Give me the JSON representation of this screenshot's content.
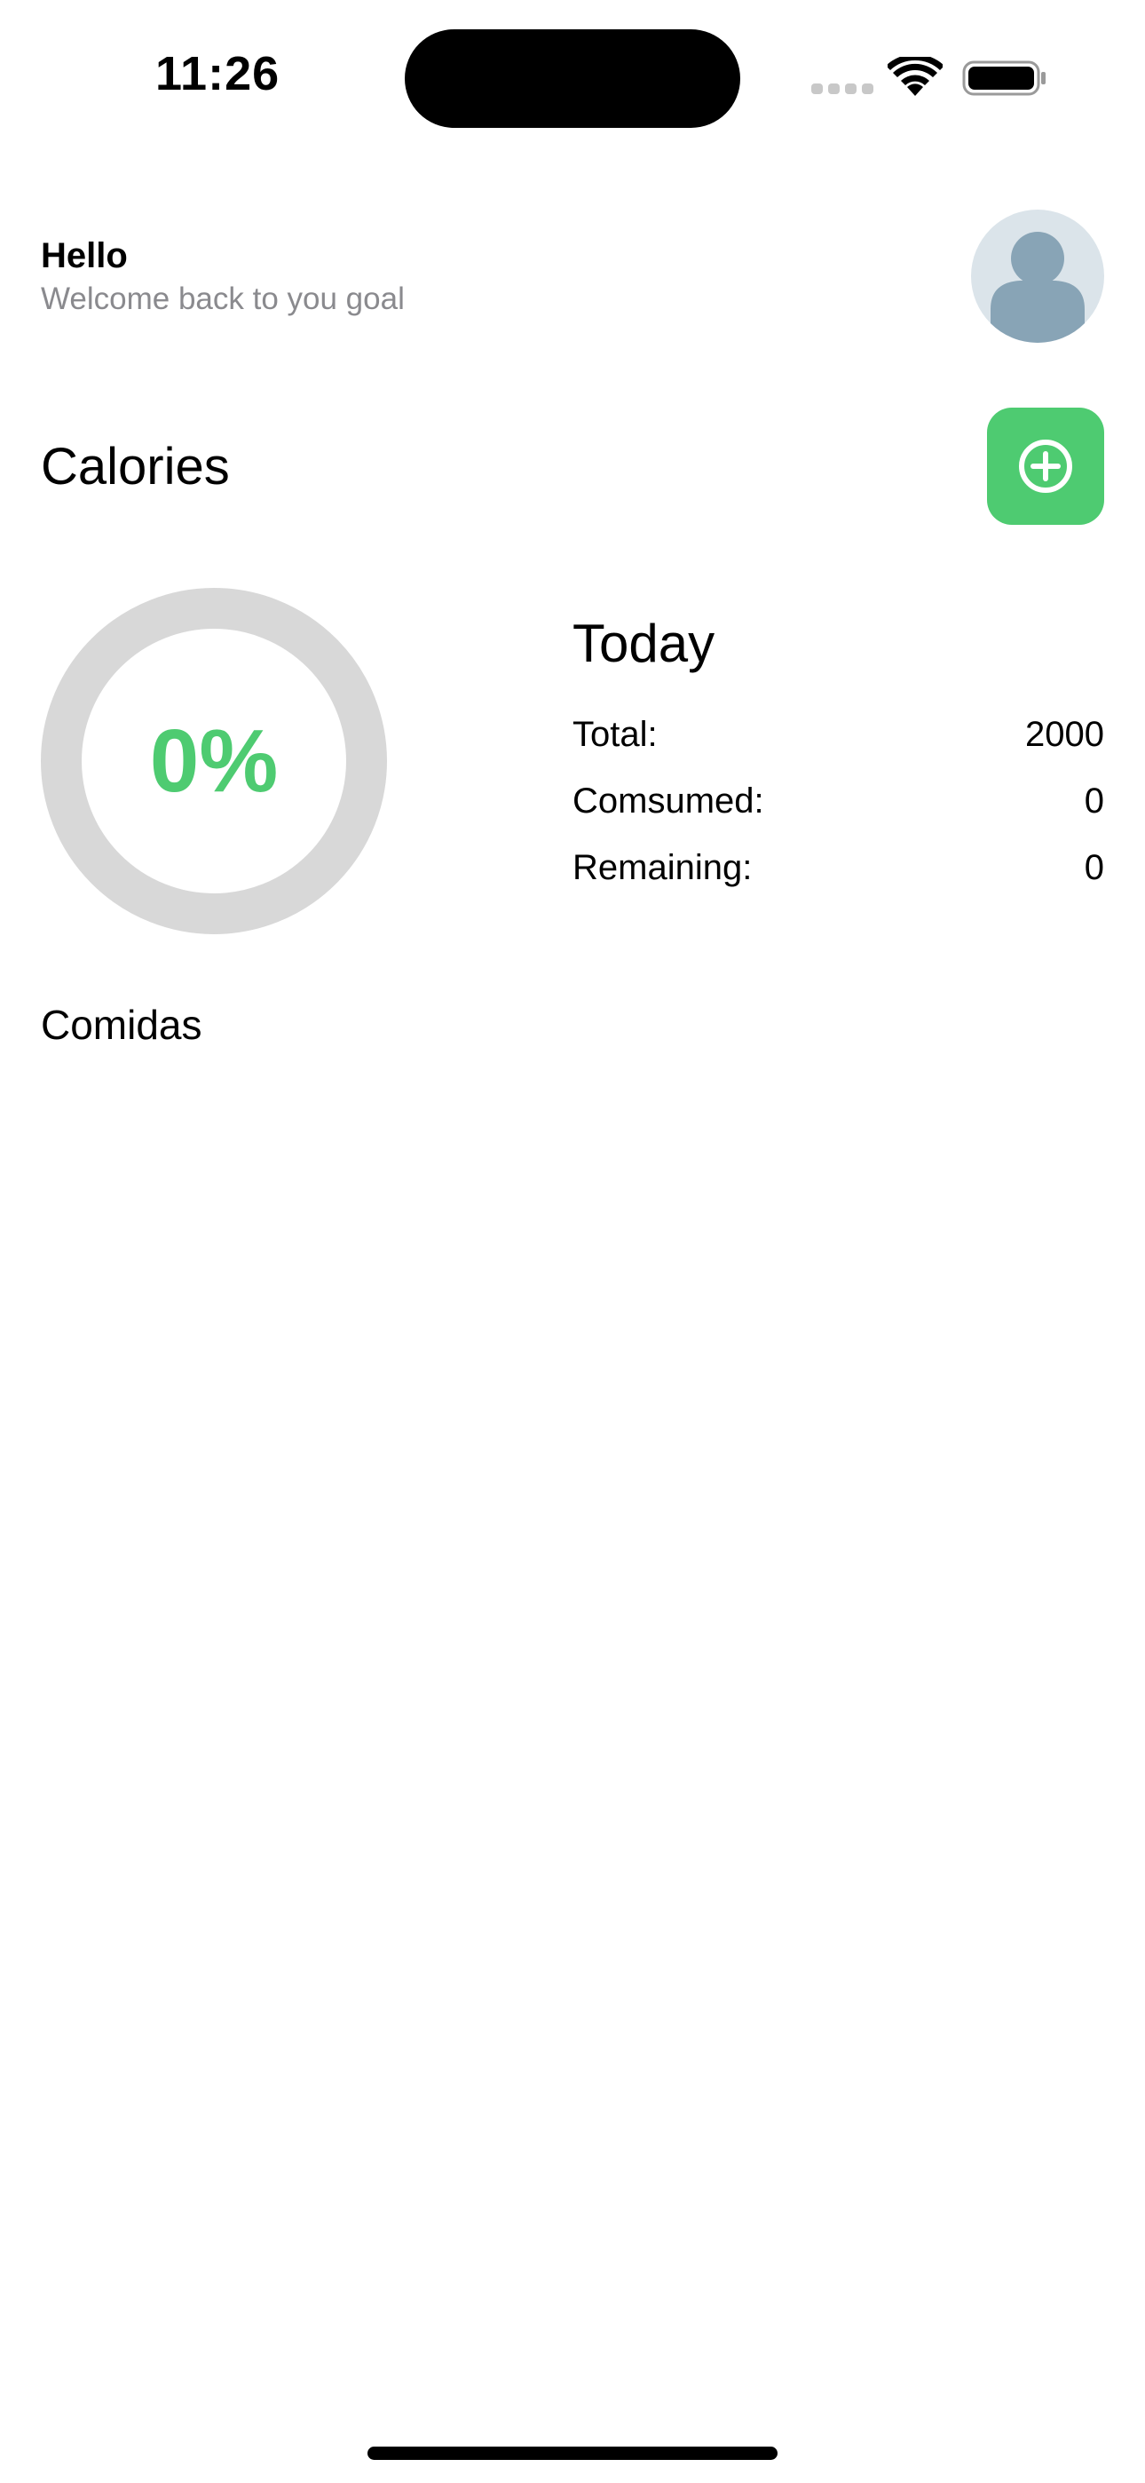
{
  "status_bar": {
    "time": "11:26"
  },
  "greeting": {
    "title": "Hello",
    "subtitle": "Welcome back to you goal"
  },
  "calories": {
    "title": "Calories",
    "progress_label": "0%",
    "progress": 0,
    "accent_color": "#4ecb71",
    "track_color": "#d8d8d8"
  },
  "today": {
    "title": "Today",
    "rows": [
      {
        "label": "Total:",
        "value": "2000"
      },
      {
        "label": "Comsumed:",
        "value": "0"
      },
      {
        "label": "Remaining:",
        "value": "0"
      }
    ]
  },
  "meals": {
    "title": "Comidas"
  },
  "icons": {
    "avatar": "person-icon",
    "add": "plus-circle-icon"
  }
}
